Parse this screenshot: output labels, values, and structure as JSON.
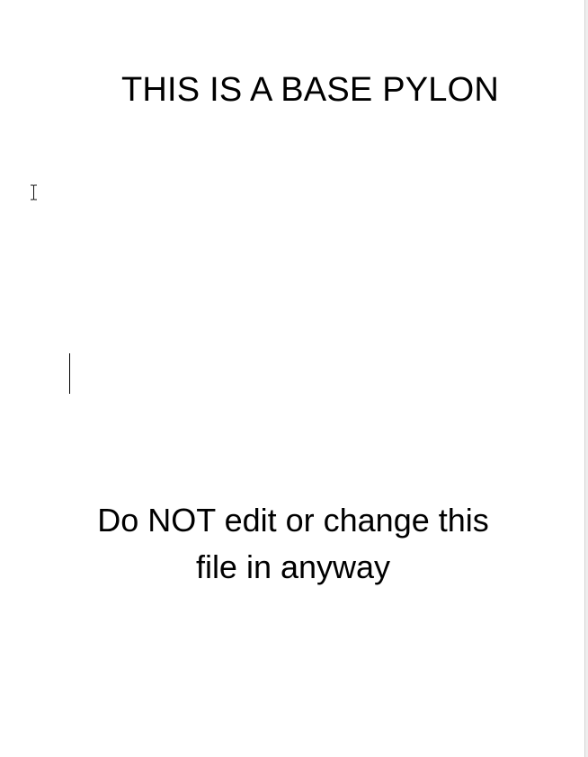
{
  "document": {
    "title": "THIS IS A BASE PYLON",
    "notice_line1": "Do NOT edit or change this",
    "notice_line2": "file in anyway"
  }
}
